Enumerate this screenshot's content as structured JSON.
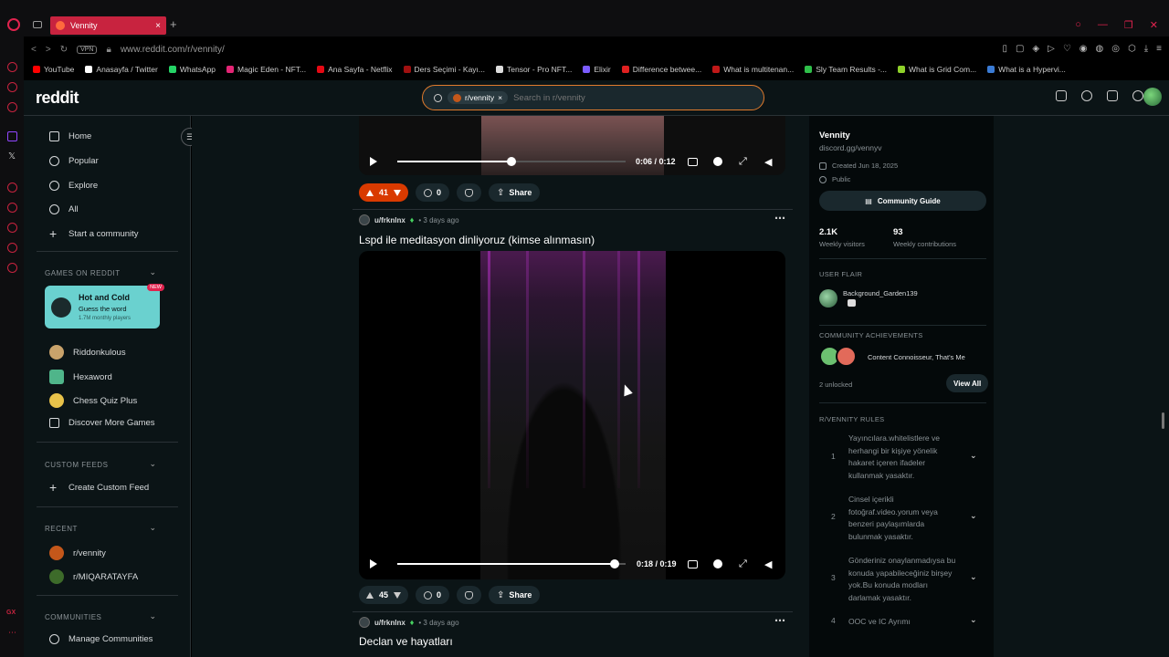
{
  "browser": {
    "tab_title": "Vennity",
    "url": "www.reddit.com/r/vennity/",
    "vpn_label": "VPN",
    "bookmarks": [
      {
        "label": "YouTube",
        "color": "#ff0000"
      },
      {
        "label": "Anasayfa / Twitter",
        "color": "#ffffff"
      },
      {
        "label": "WhatsApp",
        "color": "#25d366"
      },
      {
        "label": "Magic Eden - NFT...",
        "color": "#e42575"
      },
      {
        "label": "Ana Sayfa - Netflix",
        "color": "#e50914"
      },
      {
        "label": "Ders Seçimi - Kayı...",
        "color": "#a01010"
      },
      {
        "label": "Tensor - Pro NFT...",
        "color": "#dddddd"
      },
      {
        "label": "Elixir",
        "color": "#7b5cff"
      },
      {
        "label": "Difference betwee...",
        "color": "#e02020"
      },
      {
        "label": "What is multitenan...",
        "color": "#c01818"
      },
      {
        "label": "Sly Team Results -...",
        "color": "#2fbf4a"
      },
      {
        "label": "What is Grid Com...",
        "color": "#8fd12a"
      },
      {
        "label": "What is a Hypervi...",
        "color": "#3a7bd5"
      }
    ]
  },
  "header": {
    "logo": "reddit",
    "search_chip": "r/vennity",
    "search_placeholder": "Search in r/vennity"
  },
  "leftnav": {
    "items": [
      {
        "label": "Home",
        "icon": "home-icon"
      },
      {
        "label": "Popular",
        "icon": "popular-icon"
      },
      {
        "label": "Explore",
        "icon": "explore-icon"
      },
      {
        "label": "All",
        "icon": "all-icon"
      },
      {
        "label": "Start a community",
        "icon": "plus-icon"
      }
    ],
    "games_title": "GAMES ON REDDIT",
    "featured_game": {
      "title": "Hot and Cold",
      "subtitle": "Guess the word",
      "players": "1.7M monthly players",
      "badge": "NEW"
    },
    "games": [
      {
        "label": "Riddonkulous",
        "color": "#c9a36b"
      },
      {
        "label": "Hexaword",
        "color": "#4fb58a"
      },
      {
        "label": "Chess Quiz Plus",
        "color": "#e8c24a"
      },
      {
        "label": "Discover More Games",
        "color": "#cccccc"
      }
    ],
    "custom_feeds_title": "CUSTOM FEEDS",
    "create_feed": "Create Custom Feed",
    "recent_title": "RECENT",
    "recent": [
      {
        "label": "r/vennity",
        "color": "#c4571a"
      },
      {
        "label": "r/MIQARATAYFA",
        "color": "#3d6b2a"
      }
    ],
    "communities_title": "COMMUNITIES",
    "manage": "Manage Communities"
  },
  "posts": [
    {
      "video": {
        "time": "0:06 / 0:12",
        "progress": 0.5
      },
      "votes": "41",
      "comments": "0",
      "share": "Share"
    },
    {
      "user": "u/frknlnx",
      "time": "• 3 days ago",
      "title": "Lspd ile meditasyon dinliyoruz (kimse alınmasın)",
      "video": {
        "time": "0:18 / 0:19",
        "progress": 0.95
      },
      "votes": "45",
      "comments": "0",
      "share": "Share"
    },
    {
      "user": "u/frknlnx",
      "time": "• 3 days ago",
      "title": "Declan ve hayatları"
    }
  ],
  "sidebar": {
    "name": "Vennity",
    "link": "discord.gg/vennyv",
    "created": "Created Jun 18, 2025",
    "visibility": "Public",
    "guide_btn": "Community Guide",
    "visitors_val": "2.1K",
    "visitors_lbl": "Weekly visitors",
    "contrib_val": "93",
    "contrib_lbl": "Weekly contributions",
    "flair_title": "USER FLAIR",
    "flair_user": "Background_Garden139",
    "ach_title": "COMMUNITY ACHIEVEMENTS",
    "ach_text": "Content Connoisseur, That's Me",
    "unlocked": "2 unlocked",
    "view_all": "View All",
    "rules_title": "R/VENNITY RULES",
    "rules": [
      {
        "num": "1",
        "text": "Yayıncılara.whitelistlere ve herhangi bir kişiye yönelik hakaret içeren ifadeler kullanmak yasaktır."
      },
      {
        "num": "2",
        "text": "Cinsel içerikli fotoğraf.video.yorum veya benzeri paylaşımlarda bulunmak yasaktır."
      },
      {
        "num": "3",
        "text": "Gönderiniz onaylanmadıysa bu konuda yapabileceğiniz birşey yok.Bu konuda modları darlamak yasaktır."
      },
      {
        "num": "4",
        "text": "OOC ve IC Ayrımı"
      }
    ]
  },
  "colors": {
    "accent": "#c8233f",
    "upvote_active": "#d93a00",
    "bg": "#0b1416"
  }
}
